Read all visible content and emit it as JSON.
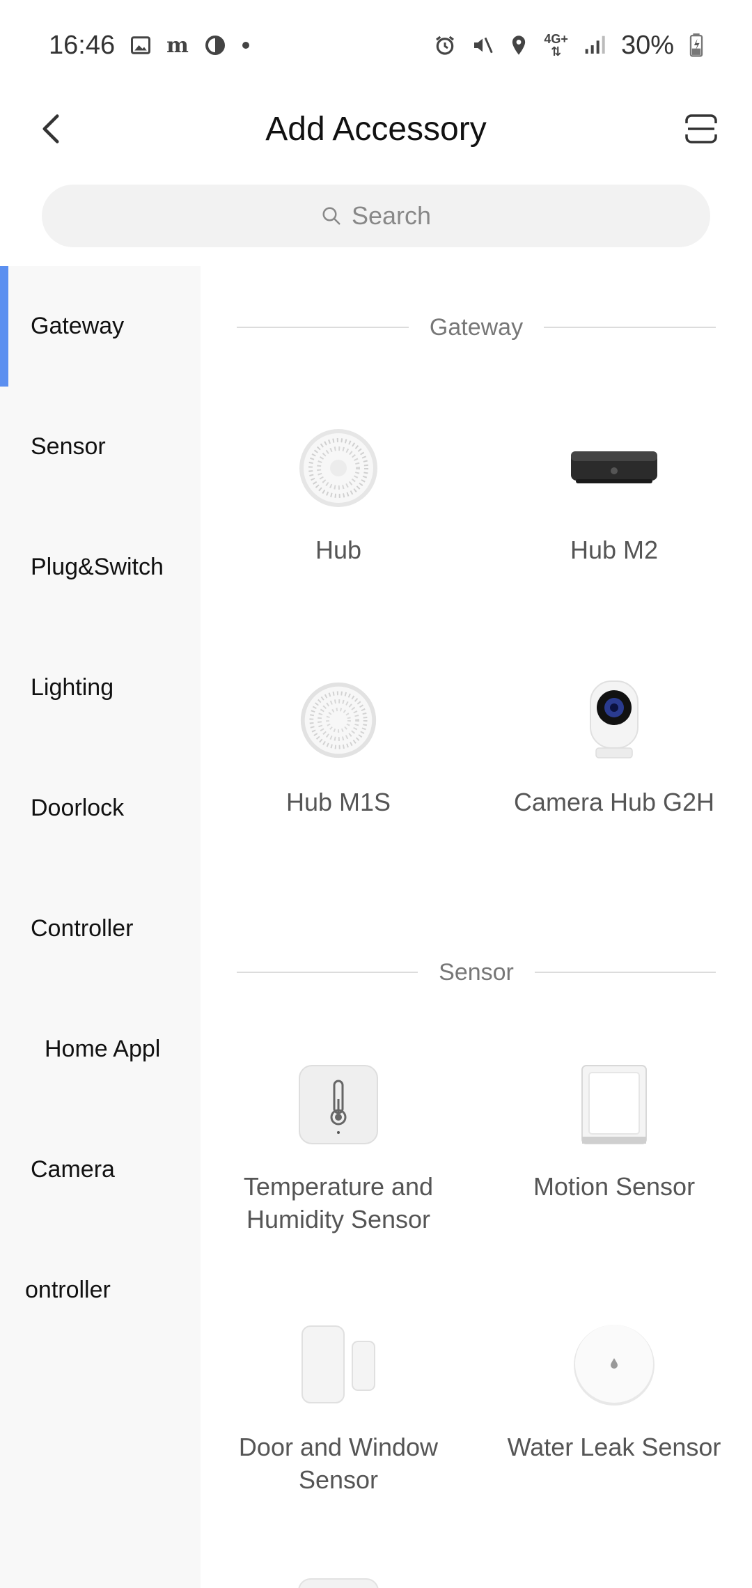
{
  "status_bar": {
    "time": "16:46",
    "battery": "30%",
    "network": "4G+",
    "left_icons": [
      "image-icon",
      "news-icon",
      "circle-app-icon",
      "dot-icon"
    ],
    "right_icons": [
      "alarm-icon",
      "mute-icon",
      "location-icon",
      "network-icon",
      "signal-icon",
      "battery-icon"
    ]
  },
  "header": {
    "title": "Add Accessory",
    "back_icon": "chevron-left-icon",
    "scan_icon": "scan-icon"
  },
  "search": {
    "placeholder": "Search",
    "icon": "search-icon"
  },
  "sidebar": {
    "items": [
      {
        "label": "Gateway",
        "active": true
      },
      {
        "label": "Sensor",
        "active": false
      },
      {
        "label": "Plug&Switch",
        "active": false
      },
      {
        "label": "Lighting",
        "active": false
      },
      {
        "label": "Doorlock",
        "active": false
      },
      {
        "label": "Controller",
        "active": false
      },
      {
        "label": "Home Appl",
        "active": false
      },
      {
        "label": "Camera",
        "active": false
      },
      {
        "label": "ontroller",
        "active": false
      }
    ],
    "accent_color": "#5b8ff0"
  },
  "sections": [
    {
      "title": "Gateway",
      "devices": [
        {
          "name": "Hub",
          "icon": "hub-icon"
        },
        {
          "name": "Hub M2",
          "icon": "hub-m2-icon"
        },
        {
          "name": "Hub M1S",
          "icon": "hub-m1s-icon"
        },
        {
          "name": "Camera Hub G2H",
          "icon": "camera-hub-icon"
        }
      ]
    },
    {
      "title": "Sensor",
      "devices": [
        {
          "name": "Temperature and Humidity Sensor",
          "icon": "thermometer-icon"
        },
        {
          "name": "Motion Sensor",
          "icon": "motion-sensor-icon"
        },
        {
          "name": "Door and Window Sensor",
          "icon": "door-sensor-icon"
        },
        {
          "name": "Water Leak Sensor",
          "icon": "water-leak-icon"
        }
      ]
    }
  ]
}
